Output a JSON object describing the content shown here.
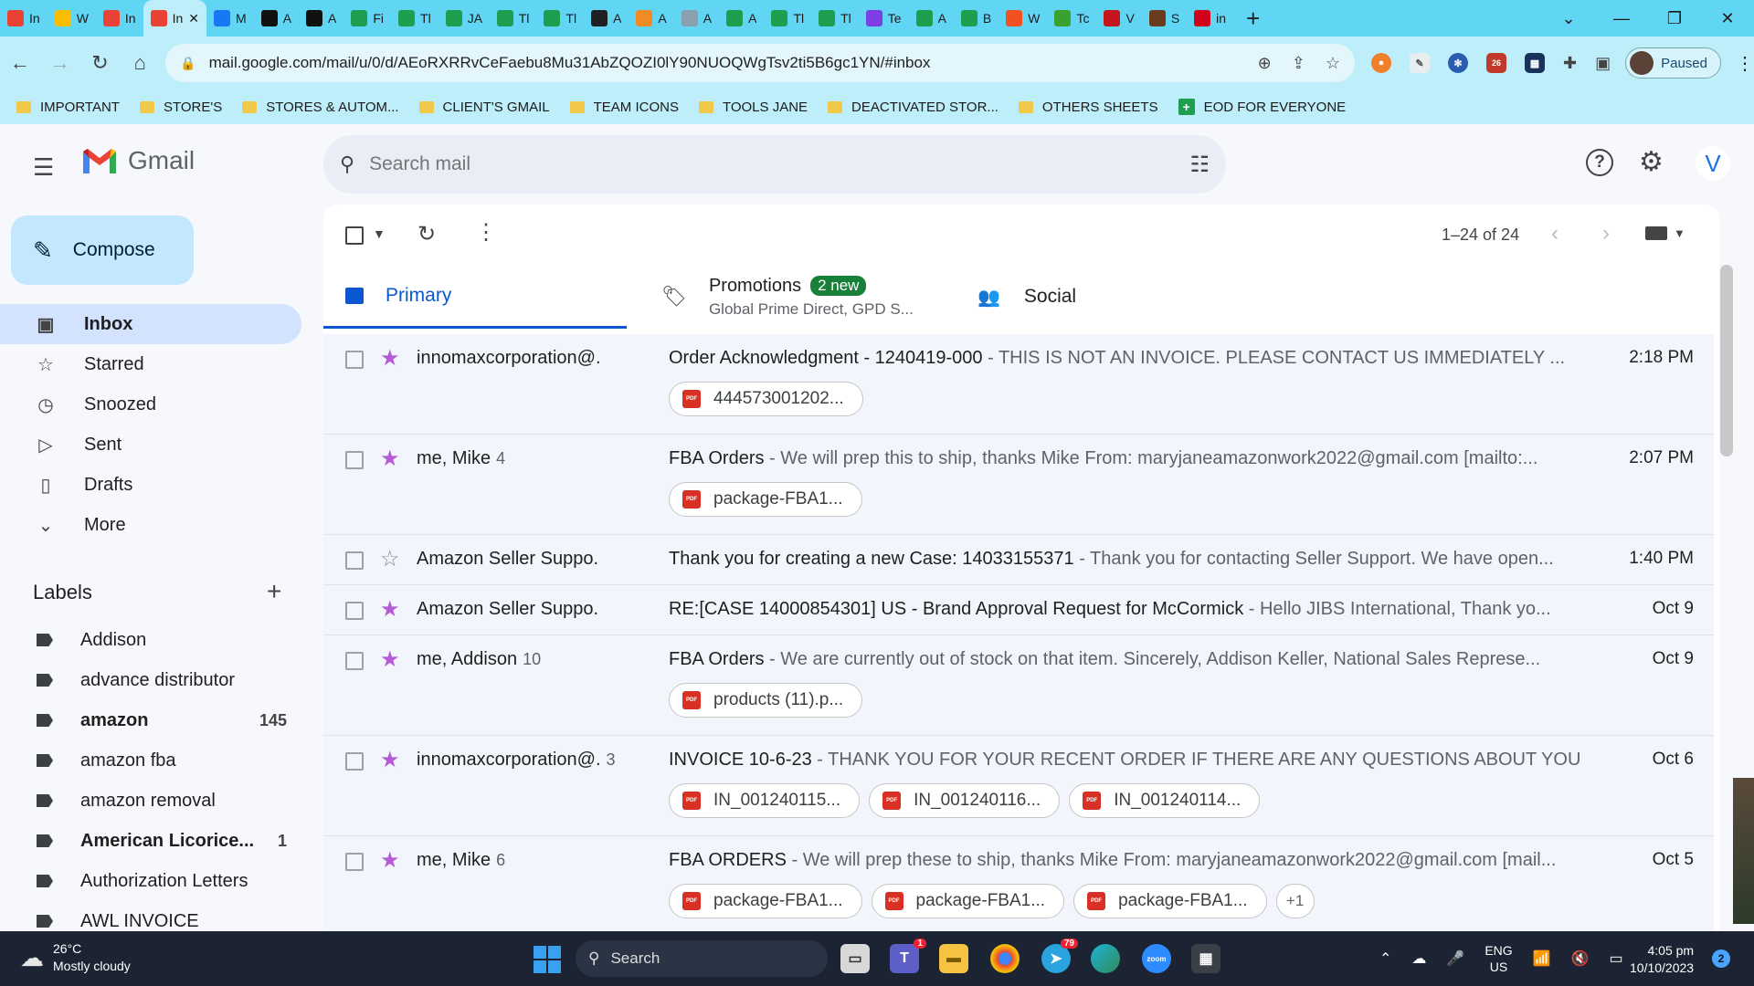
{
  "browser": {
    "tabs": [
      {
        "label": "In",
        "favicon": "gmail",
        "color": "#ea4335"
      },
      {
        "label": "W",
        "favicon": "drive",
        "color": "#fbbc04"
      },
      {
        "label": "In",
        "favicon": "gmail",
        "color": "#ea4335"
      },
      {
        "label": "In",
        "favicon": "gmail",
        "color": "#ea4335",
        "active": true
      },
      {
        "label": "M",
        "favicon": "facebook",
        "color": "#1877f2"
      },
      {
        "label": "A",
        "favicon": "amazon",
        "color": "#111111"
      },
      {
        "label": "A",
        "favicon": "amazon",
        "color": "#111111"
      },
      {
        "label": "Fi",
        "favicon": "sheets",
        "color": "#1e9e4f"
      },
      {
        "label": "Tl",
        "favicon": "sheets",
        "color": "#1e9e4f"
      },
      {
        "label": "JA",
        "favicon": "sheets",
        "color": "#1e9e4f"
      },
      {
        "label": "Tl",
        "favicon": "sheets",
        "color": "#1e9e4f"
      },
      {
        "label": "Tl",
        "favicon": "sheets",
        "color": "#1e9e4f"
      },
      {
        "label": "A",
        "favicon": "chatgpt",
        "color": "#202123"
      },
      {
        "label": "A",
        "favicon": "pen",
        "color": "#f08a24"
      },
      {
        "label": "A",
        "favicon": "globe",
        "color": "#8aa0b0"
      },
      {
        "label": "A",
        "favicon": "sheets",
        "color": "#1e9e4f"
      },
      {
        "label": "Tl",
        "favicon": "sheets",
        "color": "#1e9e4f"
      },
      {
        "label": "Tl",
        "favicon": "sheets",
        "color": "#1e9e4f"
      },
      {
        "label": "Te",
        "favicon": "chat",
        "color": "#7b3fe4"
      },
      {
        "label": "A",
        "favicon": "sheets",
        "color": "#1e9e4f"
      },
      {
        "label": "B",
        "favicon": "sheets",
        "color": "#1e9e4f"
      },
      {
        "label": "W",
        "favicon": "microsoft",
        "color": "#f25022"
      },
      {
        "label": "Tc",
        "favicon": "wix",
        "color": "#3aa02e"
      },
      {
        "label": "V",
        "favicon": "w-red",
        "color": "#c4161c"
      },
      {
        "label": "S",
        "favicon": "shield",
        "color": "#6b3b1f"
      },
      {
        "label": "in",
        "favicon": "v-red",
        "color": "#d0021b"
      }
    ],
    "url": "mail.google.com/mail/u/0/d/AEoRXRRvCeFaebu8Mu31AbZQOZI0lY90NUOQWgTsv2ti5B6gc1YN/#inbox",
    "profile_status": "Paused",
    "extension_badge": "26"
  },
  "bookmarks": [
    {
      "label": "IMPORTANT",
      "type": "folder"
    },
    {
      "label": "STORE'S",
      "type": "folder"
    },
    {
      "label": "STORES & AUTOM...",
      "type": "folder"
    },
    {
      "label": "CLIENT'S GMAIL",
      "type": "folder"
    },
    {
      "label": "TEAM ICONS",
      "type": "folder"
    },
    {
      "label": "TOOLS JANE",
      "type": "folder"
    },
    {
      "label": "DEACTIVATED STOR...",
      "type": "folder"
    },
    {
      "label": "OTHERS SHEETS",
      "type": "folder"
    },
    {
      "label": "EOD FOR EVERYONE",
      "type": "sheet"
    }
  ],
  "gmail": {
    "brand": "Gmail",
    "search_placeholder": "Search mail",
    "account_initial": "V",
    "compose_label": "Compose",
    "nav": [
      {
        "label": "Inbox",
        "icon": "inbox-icon",
        "active": true
      },
      {
        "label": "Starred",
        "icon": "star-icon"
      },
      {
        "label": "Snoozed",
        "icon": "clock-icon"
      },
      {
        "label": "Sent",
        "icon": "send-icon"
      },
      {
        "label": "Drafts",
        "icon": "draft-icon"
      },
      {
        "label": "More",
        "icon": "chevron-down-icon"
      }
    ],
    "labels_heading": "Labels",
    "labels": [
      {
        "name": "Addison",
        "count": "",
        "bold": false
      },
      {
        "name": "advance distributor",
        "count": "",
        "bold": false
      },
      {
        "name": "amazon",
        "count": "145",
        "bold": true
      },
      {
        "name": "amazon fba",
        "count": "",
        "bold": false
      },
      {
        "name": "amazon removal",
        "count": "",
        "bold": false
      },
      {
        "name": "American Licorice...",
        "count": "1",
        "bold": true
      },
      {
        "name": "Authorization Letters",
        "count": "",
        "bold": false
      },
      {
        "name": "AWL INVOICE",
        "count": "",
        "bold": false
      }
    ],
    "pagination": "1–24 of 24",
    "tabs": {
      "primary": "Primary",
      "promotions": "Promotions",
      "promotions_badge": "2 new",
      "promotions_sub": "Global Prime Direct, GPD S...",
      "social": "Social"
    },
    "emails": [
      {
        "sender": "innomaxcorporation@.",
        "count": "",
        "starred": true,
        "subject": "Order Acknowledgment - 1240419-000",
        "snippet": " - THIS IS NOT AN INVOICE. PLEASE CONTACT US IMMEDIATELY ...",
        "time": "2:18 PM",
        "attachments": [
          "444573001202..."
        ],
        "more": ""
      },
      {
        "sender": "me, Mike",
        "count": "4",
        "starred": true,
        "subject": "FBA Orders",
        "snippet": " - We will prep this to ship, thanks Mike From: maryjaneamazonwork2022@gmail.com [mailto:...",
        "time": "2:07 PM",
        "attachments": [
          "package-FBA1..."
        ],
        "more": ""
      },
      {
        "sender": "Amazon Seller Suppo.",
        "count": "",
        "starred": false,
        "subject": "Thank you for creating a new Case: 14033155371",
        "snippet": " - Thank you for contacting Seller Support. We have open...",
        "time": "1:40 PM",
        "attachments": [],
        "more": ""
      },
      {
        "sender": "Amazon Seller Suppo.",
        "count": "",
        "starred": true,
        "subject": "RE:[CASE 14000854301] US - Brand Approval Request for McCormick",
        "snippet": " - Hello JIBS International, Thank yo...",
        "time": "Oct 9",
        "attachments": [],
        "more": ""
      },
      {
        "sender": "me, Addison",
        "count": "10",
        "starred": true,
        "subject": "FBA Orders",
        "snippet": " - We are currently out of stock on that item. Sincerely, Addison Keller, National Sales Represe...",
        "time": "Oct 9",
        "attachments": [
          "products (11).p..."
        ],
        "more": ""
      },
      {
        "sender": "innomaxcorporation@.",
        "count": "3",
        "starred": true,
        "subject": "INVOICE 10-6-23",
        "snippet": " - THANK YOU FOR YOUR RECENT ORDER IF THERE ARE ANY QUESTIONS ABOUT YOUR I...",
        "time": "Oct 6",
        "attachments": [
          "IN_001240115...",
          "IN_001240116...",
          "IN_001240114..."
        ],
        "more": ""
      },
      {
        "sender": "me, Mike",
        "count": "6",
        "starred": true,
        "subject": "FBA ORDERS",
        "snippet": " - We will prep these to ship, thanks Mike From: maryjaneamazonwork2022@gmail.com [mail...",
        "time": "Oct 5",
        "attachments": [
          "package-FBA1...",
          "package-FBA1...",
          "package-FBA1..."
        ],
        "more": "+1"
      }
    ]
  },
  "taskbar": {
    "weather_temp": "26°C",
    "weather_desc": "Mostly cloudy",
    "search_label": "Search",
    "lang_top": "ENG",
    "lang_bottom": "US",
    "time": "4:05 pm",
    "date": "10/10/2023",
    "notification_count": "2",
    "teams_badge": "1",
    "telegram_badge": "79"
  },
  "colors": {
    "tabstrip": "#60d6f4",
    "toolbar": "#bfeefb",
    "accent": "#0b57d0",
    "star": "#b65ad6"
  }
}
